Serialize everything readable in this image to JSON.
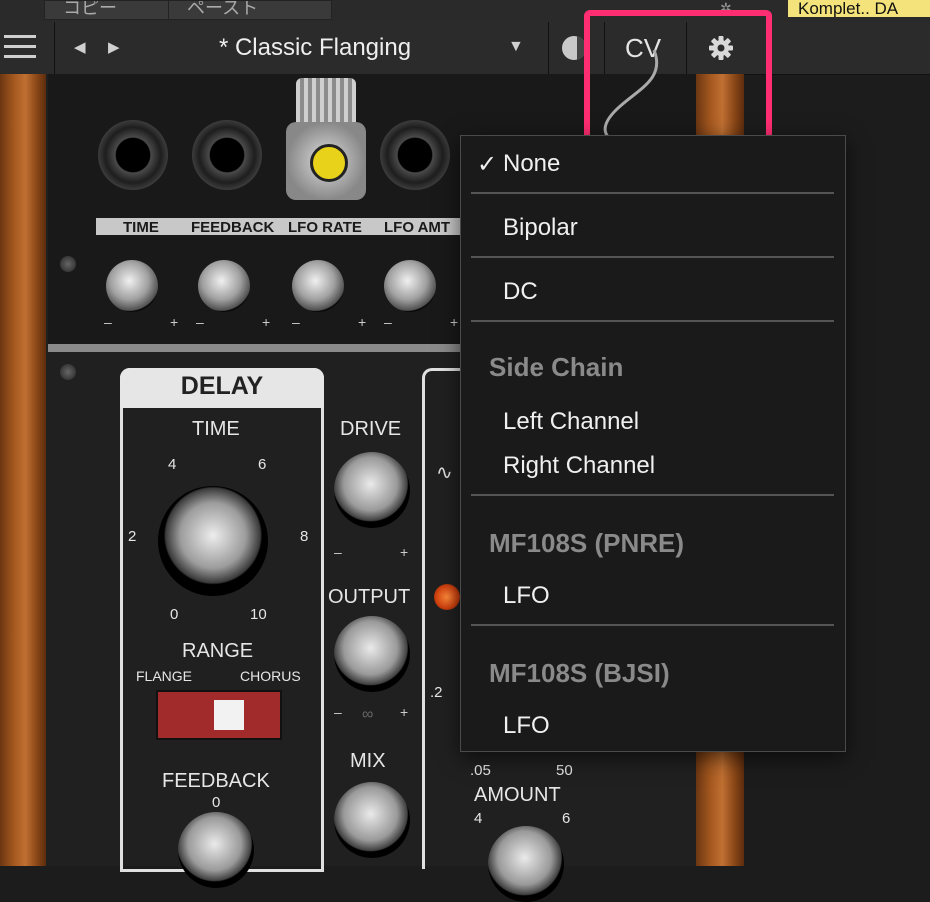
{
  "top_strip": {
    "copy_label": "コピー",
    "paste_label": "ペースト",
    "plugin_label": "Komplet.. DA"
  },
  "header": {
    "preset_name": "* Classic Flanging",
    "cv_label": "CV"
  },
  "jack_labels": [
    "TIME",
    "FEEDBACK",
    "LFO RATE",
    "LFO AMT"
  ],
  "knob_signs": {
    "minus": "–",
    "plus": "+"
  },
  "delay": {
    "title": "DELAY",
    "time_label": "TIME",
    "time_ticks": [
      "4",
      "6",
      "2",
      "8",
      "0",
      "10"
    ],
    "range_label": "RANGE",
    "range_left": "FLANGE",
    "range_right": "CHORUS",
    "feedback_label": "FEEDBACK",
    "feedback_tick": "0"
  },
  "mid": {
    "drive_label": "DRIVE",
    "output_label": "OUTPUT",
    "mix_label": "MIX"
  },
  "lfo": {
    "tick_2": ".2",
    "tick_05": ".05",
    "tick_50": "50",
    "amount_label": "AMOUNT",
    "amount_tick_4": "4",
    "amount_tick_6": "6"
  },
  "cv_menu": {
    "checkmark": "✓",
    "items": [
      {
        "label": "None",
        "type": "item",
        "checked": true
      },
      {
        "label": "Bipolar",
        "type": "item"
      },
      {
        "label": "DC",
        "type": "item"
      },
      {
        "label": "Side Chain",
        "type": "header"
      },
      {
        "label": "Left Channel",
        "type": "item"
      },
      {
        "label": "Right Channel",
        "type": "item"
      },
      {
        "label": "MF108S (PNRE)",
        "type": "header"
      },
      {
        "label": "LFO",
        "type": "item"
      },
      {
        "label": "MF108S (BJSI)",
        "type": "header"
      },
      {
        "label": "LFO",
        "type": "item"
      }
    ]
  },
  "colors": {
    "highlight": "#ff2d72",
    "menu_bg": "#1a1a1a",
    "plugin_tab": "#f3e37a"
  },
  "icons": [
    "menu-icon",
    "prev-arrow-icon",
    "next-arrow-icon",
    "dropdown-icon",
    "compare-icon",
    "gear-icon",
    "cable-icon",
    "link-icon",
    "sine-wave-icon"
  ]
}
